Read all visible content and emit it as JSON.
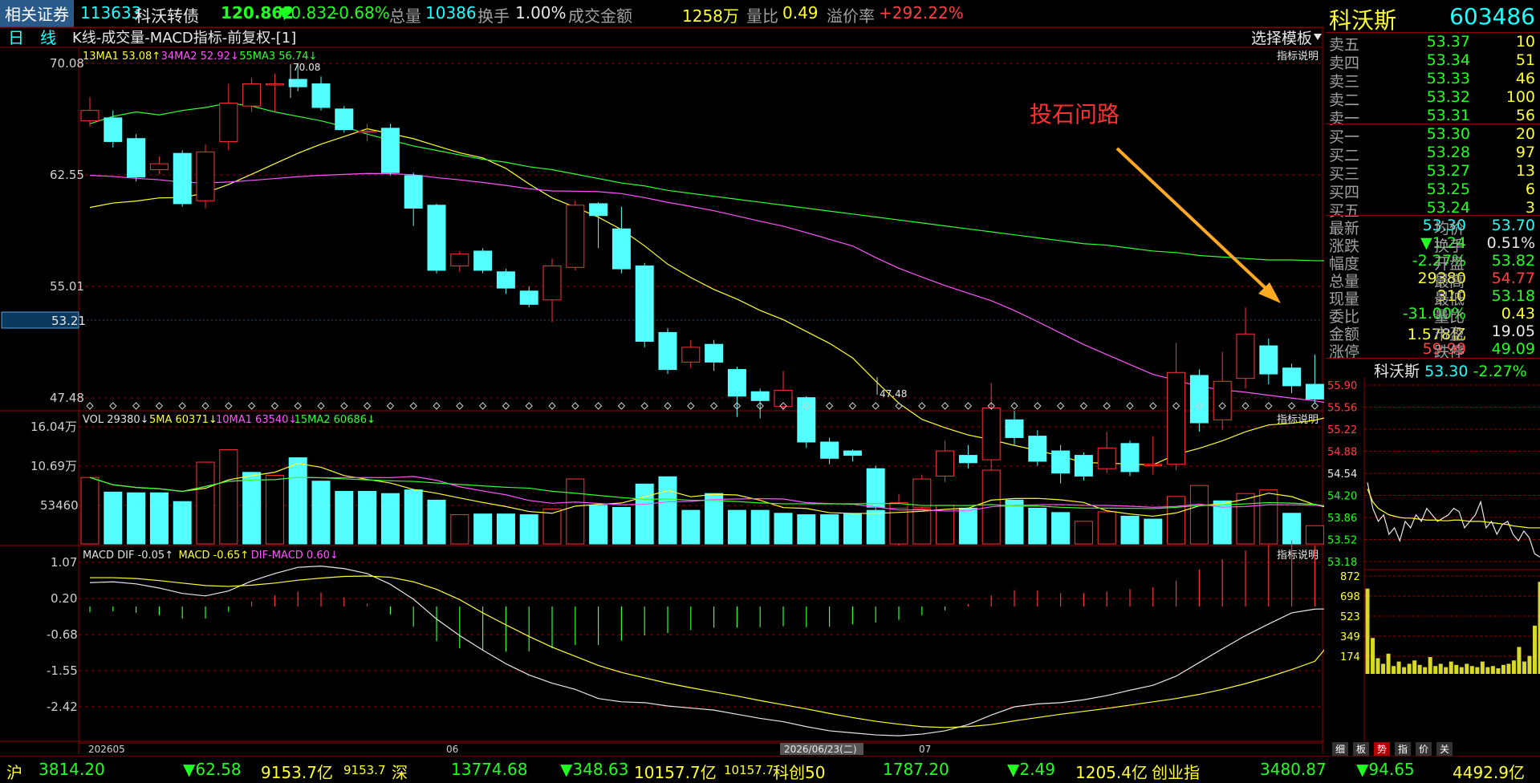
{
  "topbar": {
    "app_name": "相关证券",
    "code": "113633",
    "name": "科沃转债",
    "price": "120.862",
    "change": "▼0.832",
    "pct": "-0.68%",
    "vol_label": "总量",
    "vol": "10386",
    "turnover_label": "换手",
    "turnover": "1.00%",
    "amount_label": "成交金额",
    "amount": "1258万",
    "ratio_label": "量比",
    "ratio": "0.49",
    "premium_label": "溢价率",
    "premium": "+292.22%"
  },
  "chart_header": {
    "period": "日　线",
    "title": "K线-成交量-MACD指标-前复权-[1]",
    "template_button": "选择模板",
    "indicator_help": "指标说明"
  },
  "kline": {
    "legend": [
      {
        "text": "13MA1 53.08↑",
        "color": "#ffff33"
      },
      {
        "text": "34MA2 52.92↓",
        "color": "#ff55ff"
      },
      {
        "text": "55MA3 56.74↓",
        "color": "#33ff33"
      }
    ],
    "yticks": [
      "70.08",
      "62.55",
      "55.01",
      "47.48"
    ],
    "current_price_tag": "53.21",
    "high_label": "70.08",
    "low_label": "47.48",
    "annotation": "投石问路"
  },
  "volume": {
    "legend": [
      {
        "text": "VOL 29380↓",
        "color": "#e0e0e0"
      },
      {
        "text": "5MA 60371↓",
        "color": "#ffff33"
      },
      {
        "text": "10MA1 63540↓",
        "color": "#ff55ff"
      },
      {
        "text": "15MA2 60686↓",
        "color": "#33ff33"
      }
    ],
    "yticks": [
      "16.04万",
      "10.69万",
      "53460"
    ]
  },
  "macd": {
    "legend": [
      {
        "text": "MACD DIF -0.05↑",
        "color": "#e0e0e0"
      },
      {
        "text": "MACD -0.65↑",
        "color": "#ffff33"
      },
      {
        "text": "DIF-MACD 0.60↓",
        "color": "#ff55ff"
      }
    ],
    "yticks": [
      "1.07",
      "0.20",
      "-0.68",
      "-1.55",
      "-2.42"
    ]
  },
  "xaxis": {
    "labels": [
      "202605",
      "06",
      "07"
    ],
    "cursor_date": "2026/06/23(二)"
  },
  "stock_panel": {
    "name": "科沃斯",
    "code": "603486",
    "asks": [
      {
        "label": "卖五",
        "price": "53.37",
        "vol": "10"
      },
      {
        "label": "卖四",
        "price": "53.34",
        "vol": "51"
      },
      {
        "label": "卖三",
        "price": "53.33",
        "vol": "46"
      },
      {
        "label": "卖二",
        "price": "53.32",
        "vol": "100"
      },
      {
        "label": "卖一",
        "price": "53.31",
        "vol": "56"
      }
    ],
    "bids": [
      {
        "label": "买一",
        "price": "53.30",
        "vol": "20"
      },
      {
        "label": "买二",
        "price": "53.28",
        "vol": "97"
      },
      {
        "label": "买三",
        "price": "53.27",
        "vol": "13"
      },
      {
        "label": "买四",
        "price": "53.25",
        "vol": "6"
      },
      {
        "label": "买五",
        "price": "53.24",
        "vol": "3"
      }
    ],
    "quotes": [
      {
        "l1": "最新",
        "v1": "53.30",
        "c1": "#22ffff",
        "l2": "均价",
        "v2": "53.70",
        "c2": "#22ffff"
      },
      {
        "l1": "涨跌",
        "v1": "▼1.24",
        "c1": "#22ff22",
        "l2": "换手",
        "v2": "0.51%",
        "c2": "#e8e8e8"
      },
      {
        "l1": "幅度",
        "v1": "-2.27%",
        "c1": "#22ff22",
        "l2": "开盘",
        "v2": "53.82",
        "c2": "#22ff22"
      },
      {
        "l1": "总量",
        "v1": "29380",
        "c1": "#ffff33",
        "l2": "最高",
        "v2": "54.77",
        "c2": "#ff4040"
      },
      {
        "l1": "现量",
        "v1": "310",
        "c1": "#ffff33",
        "l2": "最低",
        "v2": "53.18",
        "c2": "#22ff22"
      },
      {
        "l1": "委比",
        "v1": "-31.00%",
        "c1": "#22ff22",
        "l2": "量比",
        "v2": "0.43",
        "c2": "#ffff33"
      },
      {
        "l1": "金额",
        "v1": "1.578亿",
        "c1": "#ffff33",
        "l2": "市盈",
        "v2": "19.05",
        "c2": "#e8e8e8"
      },
      {
        "l1": "涨停",
        "v1": "59.99",
        "c1": "#ff4040",
        "l2": "跌停",
        "v2": "49.09",
        "c2": "#22ff22"
      }
    ],
    "mini_title": "科沃斯",
    "mini_price": "53.30",
    "mini_pct": "-2.27%",
    "mini_price_ticks": [
      "55.90",
      "55.56",
      "55.22",
      "54.88",
      "54.54",
      "54.20",
      "53.86",
      "53.52",
      "53.18"
    ],
    "mini_vol_ticks": [
      "872",
      "698",
      "523",
      "349",
      "174"
    ],
    "tabs": [
      "细",
      "板",
      "势",
      "指",
      "价",
      "关"
    ],
    "active_tab": "势"
  },
  "bottombar": {
    "sh_label": "沪",
    "sh_index": "3814.20",
    "sh_chg": "▼62.58",
    "sh_amt": "9153.7亿",
    "sh_amt2": "9153.7",
    "sz_label": "深",
    "sz_index": "13774.68",
    "sz_chg": "▼348.63",
    "sz_amt": "10157.7亿",
    "sz_amt2": "10157.7",
    "kc_label": "科创50",
    "kc_index": "1787.20",
    "kc_chg": "▼2.49",
    "kc_amt": "1205.4亿",
    "cy_label": "创业指",
    "cy_index": "3480.87",
    "cy_chg": "▼94.65",
    "cy_amt": "4492.9亿"
  },
  "colors": {
    "up": "#ff3232",
    "down": "#54ffff",
    "ma13": "#ffff33",
    "ma34": "#ff55ff",
    "ma55": "#33ff33",
    "grid": "#8b0000",
    "annotation": "#ff3030",
    "arrow": "#ffaa22"
  },
  "candles": [
    [
      66.2,
      66.9,
      65.8,
      67.8
    ],
    [
      66.4,
      64.8,
      64.4,
      66.9
    ],
    [
      65.0,
      62.4,
      62.1,
      65.3
    ],
    [
      62.9,
      63.3,
      62.6,
      63.8
    ],
    [
      64.0,
      60.6,
      60.4,
      64.2
    ],
    [
      60.8,
      64.1,
      60.3,
      64.6
    ],
    [
      64.8,
      67.4,
      64.2,
      68.7
    ],
    [
      67.2,
      68.7,
      66.8,
      69.1
    ],
    [
      68.7,
      68.7,
      66.8,
      69.4
    ],
    [
      69.0,
      68.5,
      68.2,
      70.1
    ],
    [
      68.7,
      67.1,
      66.9,
      69.2
    ],
    [
      67.0,
      65.6,
      65.4,
      67.2
    ],
    [
      65.5,
      65.5,
      64.8,
      66.0
    ],
    [
      65.7,
      62.7,
      62.5,
      66.0
    ],
    [
      62.5,
      60.3,
      59.1,
      62.7
    ],
    [
      60.5,
      56.1,
      55.9,
      60.6
    ],
    [
      56.4,
      57.2,
      56.0,
      57.4
    ],
    [
      57.4,
      56.1,
      55.9,
      57.6
    ],
    [
      56.0,
      54.9,
      54.5,
      56.2
    ],
    [
      54.7,
      53.8,
      53.6,
      55.0
    ],
    [
      54.1,
      56.4,
      52.6,
      56.9
    ],
    [
      56.3,
      60.5,
      56.1,
      60.8
    ],
    [
      60.6,
      59.8,
      57.6,
      60.7
    ],
    [
      58.9,
      56.2,
      55.9,
      60.4
    ],
    [
      56.4,
      51.3,
      50.9,
      56.6
    ],
    [
      51.9,
      49.4,
      49.1,
      52.2
    ],
    [
      49.9,
      50.9,
      49.5,
      51.4
    ],
    [
      51.1,
      49.9,
      49.3,
      51.4
    ],
    [
      49.4,
      47.6,
      46.2,
      49.6
    ],
    [
      47.9,
      47.3,
      46.1,
      48.1
    ],
    [
      46.9,
      48.0,
      46.6,
      49.3
    ],
    [
      47.5,
      44.5,
      44.1,
      47.6
    ],
    [
      44.5,
      43.4,
      43.0,
      44.8
    ],
    [
      43.9,
      43.6,
      43.2,
      44.0
    ],
    [
      42.7,
      40.1,
      39.9,
      42.9
    ],
    [
      39.6,
      40.4,
      37.5,
      41.0
    ],
    [
      40.1,
      42.0,
      39.4,
      42.3
    ],
    [
      42.2,
      43.9,
      41.8,
      44.6
    ],
    [
      43.6,
      43.1,
      42.7,
      44.3
    ],
    [
      43.3,
      46.8,
      42.5,
      48.5
    ],
    [
      46.0,
      44.8,
      44.3,
      46.6
    ],
    [
      44.9,
      43.2,
      42.9,
      45.3
    ],
    [
      43.9,
      42.4,
      41.7,
      44.3
    ],
    [
      43.6,
      42.2,
      41.9,
      43.8
    ],
    [
      42.7,
      44.1,
      42.4,
      45.2
    ],
    [
      44.4,
      42.5,
      42.2,
      44.6
    ],
    [
      42.9,
      43.0,
      42.3,
      44.9
    ],
    [
      43.0,
      49.2,
      42.6,
      51.2
    ],
    [
      49.0,
      45.8,
      45.2,
      49.4
    ],
    [
      46.0,
      48.6,
      45.3,
      50.6
    ],
    [
      48.8,
      51.8,
      48.1,
      53.6
    ],
    [
      51.0,
      49.1,
      48.4,
      51.5
    ],
    [
      49.5,
      48.3,
      47.8,
      49.8
    ],
    [
      48.4,
      47.4,
      47.1,
      50.4
    ],
    [
      47.2,
      48.3,
      46.9,
      49.2
    ]
  ],
  "volumes": [
    [
      91,
      1
    ],
    [
      71,
      0
    ],
    [
      70,
      0
    ],
    [
      70,
      0
    ],
    [
      58,
      0
    ],
    [
      112,
      1
    ],
    [
      129,
      1
    ],
    [
      98,
      0
    ],
    [
      94,
      1
    ],
    [
      118,
      0
    ],
    [
      86,
      0
    ],
    [
      72,
      0
    ],
    [
      72,
      0
    ],
    [
      69,
      0
    ],
    [
      74,
      0
    ],
    [
      60,
      0
    ],
    [
      40,
      1
    ],
    [
      41,
      0
    ],
    [
      41,
      0
    ],
    [
      40,
      0
    ],
    [
      48,
      1
    ],
    [
      89,
      1
    ],
    [
      53,
      0
    ],
    [
      50,
      0
    ],
    [
      82,
      0
    ],
    [
      92,
      0
    ],
    [
      46,
      0
    ],
    [
      69,
      0
    ],
    [
      46,
      0
    ],
    [
      46,
      0
    ],
    [
      42,
      0
    ],
    [
      40,
      0
    ],
    [
      40,
      0
    ],
    [
      41,
      0
    ],
    [
      46,
      0
    ],
    [
      49,
      1
    ],
    [
      48,
      1
    ],
    [
      53,
      1
    ],
    [
      49,
      0
    ],
    [
      101,
      1
    ],
    [
      60,
      0
    ],
    [
      49,
      0
    ],
    [
      43,
      0
    ],
    [
      31,
      1
    ],
    [
      44,
      1
    ],
    [
      38,
      0
    ],
    [
      34,
      0
    ],
    [
      65,
      1
    ],
    [
      80,
      1
    ],
    [
      59,
      0
    ],
    [
      69,
      1
    ],
    [
      74,
      1
    ],
    [
      42,
      0
    ],
    [
      25,
      1
    ],
    [
      24,
      0
    ]
  ],
  "macd_dif": [
    0.58,
    0.6,
    0.55,
    0.45,
    0.32,
    0.26,
    0.38,
    0.62,
    0.8,
    0.95,
    0.98,
    0.92,
    0.8,
    0.54,
    0.18,
    -0.3,
    -0.7,
    -1.05,
    -1.38,
    -1.65,
    -1.85,
    -2.0,
    -2.22,
    -2.3,
    -2.32,
    -2.4,
    -2.45,
    -2.5,
    -2.6,
    -2.7,
    -2.78,
    -2.9,
    -3.0,
    -3.05,
    -3.1,
    -3.12,
    -3.08,
    -3.0,
    -2.85,
    -2.62,
    -2.42,
    -2.35,
    -2.32,
    -2.25,
    -2.15,
    -2.02,
    -1.9,
    -1.68,
    -1.35,
    -1.02,
    -0.7,
    -0.42,
    -0.15,
    -0.06,
    -0.05
  ],
  "macd_dea": [
    0.7,
    0.7,
    0.68,
    0.63,
    0.57,
    0.51,
    0.49,
    0.52,
    0.57,
    0.64,
    0.69,
    0.73,
    0.74,
    0.71,
    0.6,
    0.42,
    0.17,
    -0.15,
    -0.44,
    -0.72,
    -0.98,
    -1.2,
    -1.42,
    -1.59,
    -1.72,
    -1.85,
    -1.96,
    -2.06,
    -2.16,
    -2.27,
    -2.37,
    -2.47,
    -2.58,
    -2.68,
    -2.77,
    -2.84,
    -2.9,
    -2.92,
    -2.9,
    -2.85,
    -2.76,
    -2.68,
    -2.6,
    -2.53,
    -2.46,
    -2.38,
    -2.3,
    -2.22,
    -2.12,
    -2.0,
    -1.86,
    -1.7,
    -1.52,
    -1.32,
    -0.65
  ],
  "mini_price_series": [
    54.4,
    54.0,
    53.8,
    53.9,
    53.6,
    53.7,
    53.5,
    53.8,
    53.7,
    53.9,
    53.8,
    54.0,
    53.9,
    53.8,
    53.85,
    53.9,
    54.0,
    53.95,
    53.7,
    53.8,
    53.9,
    54.1,
    53.7,
    53.8,
    53.6,
    53.75,
    53.8,
    53.6,
    53.5,
    53.65,
    53.55,
    53.3,
    53.25
  ],
  "mini_avg_series": [
    54.3,
    54.1,
    54.0,
    53.95,
    53.9,
    53.88,
    53.86,
    53.85,
    53.85,
    53.84,
    53.83,
    53.82,
    53.82,
    53.82,
    53.81,
    53.81,
    53.82,
    53.82,
    53.81,
    53.8,
    53.8,
    53.8,
    53.79,
    53.78,
    53.77,
    53.76,
    53.75,
    53.73,
    53.72,
    53.71,
    53.7,
    53.7,
    53.7
  ],
  "mini_vol_series": [
    760,
    320,
    140,
    90,
    180,
    70,
    110,
    60,
    90,
    120,
    80,
    60,
    150,
    70,
    90,
    60,
    110,
    80,
    60,
    90,
    70,
    60,
    110,
    60,
    70,
    50,
    80,
    90,
    120,
    240,
    110,
    160,
    430,
    820
  ]
}
